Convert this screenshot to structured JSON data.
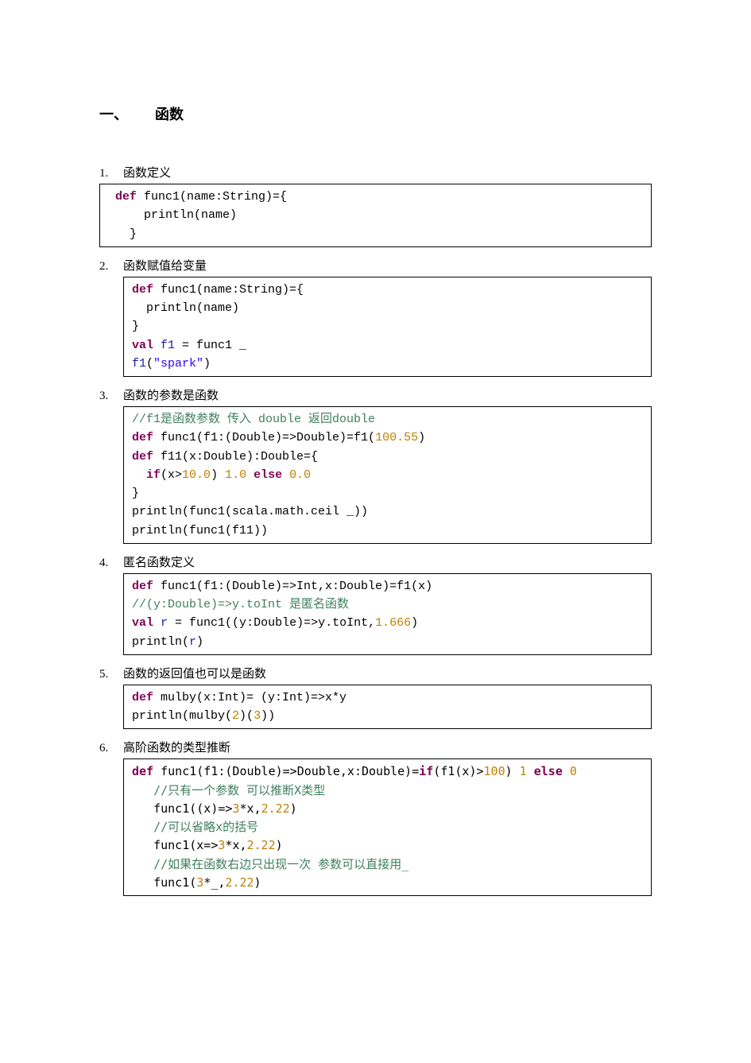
{
  "heading": {
    "number": "一、",
    "title": "函数"
  },
  "sections": [
    {
      "num": "1.",
      "title": "函数定义",
      "box": "first",
      "lines": [
        [
          {
            "t": " "
          },
          {
            "t": "def",
            "c": "kw"
          },
          {
            "t": " func1(name:String)={"
          }
        ],
        [
          {
            "t": "     println(name)"
          }
        ],
        [
          {
            "t": "   }"
          }
        ]
      ]
    },
    {
      "num": "2.",
      "title": "函数赋值给变量",
      "box": "std",
      "lines": [
        [
          {
            "t": "def",
            "c": "kw"
          },
          {
            "t": " func1(name:String)={"
          }
        ],
        [
          {
            "t": "  println(name)"
          }
        ],
        [
          {
            "t": "}"
          }
        ],
        [
          {
            "t": "val",
            "c": "kw"
          },
          {
            "t": " "
          },
          {
            "t": "f1",
            "c": "ident-blue"
          },
          {
            "t": " = func1 _"
          }
        ],
        [
          {
            "t": "f1",
            "c": "ident-blue"
          },
          {
            "t": "("
          },
          {
            "t": "\"spark\"",
            "c": "str"
          },
          {
            "t": ")"
          }
        ]
      ]
    },
    {
      "num": "3.",
      "title": "函数的参数是函数",
      "box": "std",
      "lines": [
        [
          {
            "t": "//f1是函数参数 传入 double 返回double",
            "c": "cmt"
          }
        ],
        [
          {
            "t": "def",
            "c": "kw"
          },
          {
            "t": " func1(f1:(Double)=>Double)=f1("
          },
          {
            "t": "100.55",
            "c": "num-lit"
          },
          {
            "t": ")"
          }
        ],
        [
          {
            "t": "def",
            "c": "kw"
          },
          {
            "t": " f11(x:Double):Double={"
          }
        ],
        [
          {
            "t": "  "
          },
          {
            "t": "if",
            "c": "kw"
          },
          {
            "t": "(x>"
          },
          {
            "t": "10.0",
            "c": "num-lit"
          },
          {
            "t": ") "
          },
          {
            "t": "1.0",
            "c": "num-lit"
          },
          {
            "t": " "
          },
          {
            "t": "else",
            "c": "kw"
          },
          {
            "t": " "
          },
          {
            "t": "0.0",
            "c": "num-lit"
          }
        ],
        [
          {
            "t": "}"
          }
        ],
        [
          {
            "t": "println(func1(scala.math.ceil _))"
          }
        ],
        [
          {
            "t": "println(func1(f11))"
          }
        ]
      ]
    },
    {
      "num": "4.",
      "title": "匿名函数定义",
      "box": "std",
      "lines": [
        [
          {
            "t": "def",
            "c": "kw"
          },
          {
            "t": " func1(f1:(Double)=>Int,x:Double)=f1(x)"
          }
        ],
        [
          {
            "t": "//(y:Double)=>y.toInt 是匿名函数",
            "c": "cmt"
          }
        ],
        [
          {
            "t": "val",
            "c": "kw"
          },
          {
            "t": " "
          },
          {
            "t": "r",
            "c": "ident-blue"
          },
          {
            "t": " = func1((y:Double)=>y.toInt,"
          },
          {
            "t": "1.666",
            "c": "num-lit"
          },
          {
            "t": ")"
          }
        ],
        [
          {
            "t": "println("
          },
          {
            "t": "r",
            "c": "ident-blue"
          },
          {
            "t": ")"
          }
        ]
      ]
    },
    {
      "num": "5.",
      "title": "函数的返回值也可以是函数",
      "box": "std",
      "lines": [
        [
          {
            "t": "def",
            "c": "kw"
          },
          {
            "t": " mulby(x:Int)= (y:Int)=>x*y"
          }
        ],
        [
          {
            "t": "println(mulby("
          },
          {
            "t": "2",
            "c": "num-lit"
          },
          {
            "t": ")("
          },
          {
            "t": "3",
            "c": "num-lit"
          },
          {
            "t": "))"
          }
        ]
      ]
    },
    {
      "num": "6.",
      "title": "高阶函数的类型推断",
      "box": "simsun",
      "lines": [
        [
          {
            "t": "def",
            "c": "kw"
          },
          {
            "t": " func1(f1:(Double)=>Double,x:Double)="
          },
          {
            "t": "if",
            "c": "kw"
          },
          {
            "t": "(f1(x)>"
          },
          {
            "t": "100",
            "c": "num-lit"
          },
          {
            "t": ") "
          },
          {
            "t": "1",
            "c": "num-lit"
          },
          {
            "t": " "
          },
          {
            "t": "else",
            "c": "kw"
          },
          {
            "t": " "
          },
          {
            "t": "0",
            "c": "num-lit"
          }
        ],
        [
          {
            "t": "   "
          },
          {
            "t": "//只有一个参数 可以推断X类型",
            "c": "cmt"
          }
        ],
        [
          {
            "t": "   func1((x)=>"
          },
          {
            "t": "3",
            "c": "num-lit"
          },
          {
            "t": "*x,"
          },
          {
            "t": "2.22",
            "c": "num-lit"
          },
          {
            "t": ")"
          }
        ],
        [
          {
            "t": "   "
          },
          {
            "t": "//可以省略x的括号",
            "c": "cmt"
          }
        ],
        [
          {
            "t": "   func1(x=>"
          },
          {
            "t": "3",
            "c": "num-lit"
          },
          {
            "t": "*x,"
          },
          {
            "t": "2.22",
            "c": "num-lit"
          },
          {
            "t": ")"
          }
        ],
        [
          {
            "t": "   "
          },
          {
            "t": "//如果在函数右边只出现一次 参数可以直接用_",
            "c": "cmt"
          }
        ],
        [
          {
            "t": "   func1("
          },
          {
            "t": "3",
            "c": "num-lit"
          },
          {
            "t": "*_,"
          },
          {
            "t": "2.22",
            "c": "num-lit"
          },
          {
            "t": ")"
          }
        ]
      ]
    }
  ]
}
